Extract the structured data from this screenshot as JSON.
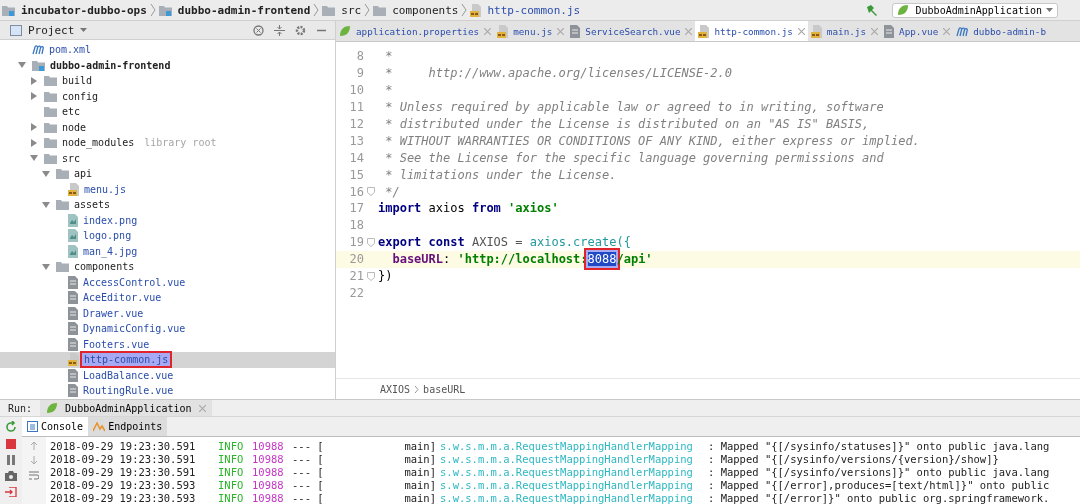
{
  "breadcrumb": [
    {
      "label": "incubator-dubbo-ops",
      "kind": "module"
    },
    {
      "label": "dubbo-admin-frontend",
      "kind": "module"
    },
    {
      "label": "src",
      "kind": "folder"
    },
    {
      "label": "components",
      "kind": "folder"
    },
    {
      "label": "http-common.js",
      "kind": "js"
    }
  ],
  "run_config": {
    "label": "DubboAdminApplication"
  },
  "project_panel": {
    "title": "Project",
    "tree": [
      {
        "label": "pom.xml",
        "kind": "maven",
        "selected": false
      },
      {
        "label": "dubbo-admin-frontend",
        "kind": "module",
        "expanded": true,
        "selected": false,
        "children": [
          {
            "label": "build",
            "kind": "folder",
            "expanded": false,
            "selected": false
          },
          {
            "label": "config",
            "kind": "folder",
            "expanded": false,
            "selected": false
          },
          {
            "label": "etc",
            "kind": "folder",
            "selected": false
          },
          {
            "label": "node",
            "kind": "folder",
            "expanded": false,
            "selected": false
          },
          {
            "label": "node_modules",
            "kind": "folder",
            "expanded": false,
            "selected": false,
            "note": "library root"
          },
          {
            "label": "src",
            "kind": "folder",
            "expanded": true,
            "selected": false,
            "children": [
              {
                "label": "api",
                "kind": "folder",
                "expanded": true,
                "selected": false,
                "children": [
                  {
                    "label": "menu.js",
                    "kind": "js",
                    "selected": false
                  }
                ]
              },
              {
                "label": "assets",
                "kind": "folder",
                "expanded": true,
                "selected": false,
                "children": [
                  {
                    "label": "index.png",
                    "kind": "image",
                    "selected": false
                  },
                  {
                    "label": "logo.png",
                    "kind": "image",
                    "selected": false
                  },
                  {
                    "label": "man_4.jpg",
                    "kind": "image",
                    "selected": false
                  }
                ]
              },
              {
                "label": "components",
                "kind": "folder",
                "expanded": true,
                "selected": false,
                "children": [
                  {
                    "label": "AccessControl.vue",
                    "kind": "vue",
                    "selected": false
                  },
                  {
                    "label": "AceEditor.vue",
                    "kind": "vue",
                    "selected": false
                  },
                  {
                    "label": "Drawer.vue",
                    "kind": "vue",
                    "selected": false
                  },
                  {
                    "label": "DynamicConfig.vue",
                    "kind": "vue",
                    "selected": false
                  },
                  {
                    "label": "Footers.vue",
                    "kind": "vue",
                    "selected": false
                  },
                  {
                    "label": "http-common.js",
                    "kind": "js",
                    "selected": true,
                    "annotated": true
                  },
                  {
                    "label": "LoadBalance.vue",
                    "kind": "vue",
                    "selected": false
                  },
                  {
                    "label": "RoutingRule.vue",
                    "kind": "vue",
                    "selected": false
                  }
                ]
              }
            ]
          }
        ]
      }
    ]
  },
  "editor_tabs": [
    {
      "label": "application.properties",
      "kind": "spring",
      "selected": false,
      "closable": true
    },
    {
      "label": "menu.js",
      "kind": "js",
      "selected": false,
      "closable": true
    },
    {
      "label": "ServiceSearch.vue",
      "kind": "vue",
      "selected": false,
      "closable": true
    },
    {
      "label": "http-common.js",
      "kind": "js",
      "selected": true,
      "closable": true
    },
    {
      "label": "main.js",
      "kind": "js",
      "selected": false,
      "closable": true
    },
    {
      "label": "App.vue",
      "kind": "vue",
      "selected": false,
      "closable": true
    },
    {
      "label": "dubbo-admin-b",
      "kind": "maven",
      "selected": false,
      "closable": false
    }
  ],
  "code_lines": [
    {
      "number": "8",
      "segments": [
        {
          "kind": "comment",
          "text": " *"
        }
      ]
    },
    {
      "number": "9",
      "segments": [
        {
          "kind": "comment",
          "text": " *     http://www.apache.org/licenses/LICENSE-2.0"
        }
      ]
    },
    {
      "number": "10",
      "segments": [
        {
          "kind": "comment",
          "text": " *"
        }
      ]
    },
    {
      "number": "11",
      "segments": [
        {
          "kind": "comment",
          "text": " * Unless required by applicable law or agreed to in writing, software"
        }
      ]
    },
    {
      "number": "12",
      "segments": [
        {
          "kind": "comment",
          "text": " * distributed under the License is distributed on an \"AS IS\" BASIS,"
        }
      ]
    },
    {
      "number": "13",
      "segments": [
        {
          "kind": "comment",
          "text": " * WITHOUT WARRANTIES OR CONDITIONS OF ANY KIND, either express or implied."
        }
      ]
    },
    {
      "number": "14",
      "segments": [
        {
          "kind": "comment",
          "text": " * See the License for the specific language governing permissions and"
        }
      ]
    },
    {
      "number": "15",
      "segments": [
        {
          "kind": "comment",
          "text": " * limitations under the License."
        }
      ]
    },
    {
      "number": "16",
      "fold": true,
      "segments": [
        {
          "kind": "comment",
          "text": " */"
        }
      ]
    },
    {
      "number": "17",
      "segments": [
        {
          "kind": "keyword",
          "text": "import"
        },
        {
          "kind": "plain",
          "text": " axios "
        },
        {
          "kind": "keyword",
          "text": "from"
        },
        {
          "kind": "string",
          "text": " 'axios'"
        }
      ]
    },
    {
      "number": "18"
    },
    {
      "number": "19",
      "fold": true,
      "segments": [
        {
          "kind": "keyword",
          "text": "export"
        },
        {
          "kind": "keyword",
          "text": " const"
        },
        {
          "kind": "constant",
          "text": " AXIOS ="
        },
        {
          "kind": "ident",
          "text": " axios.create({"
        }
      ]
    },
    {
      "number": "20",
      "current": true,
      "segments": [
        {
          "kind": "property",
          "text": "  baseURL"
        },
        {
          "kind": "plain",
          "text": ":"
        },
        {
          "kind": "string",
          "text": " 'http://localhost:"
        },
        {
          "kind": "selection",
          "text": "8088",
          "annotated": true
        },
        {
          "kind": "string",
          "text": "/api'"
        }
      ]
    },
    {
      "number": "21",
      "fold": true,
      "segments": [
        {
          "kind": "plain",
          "text": "})"
        }
      ]
    },
    {
      "number": "22"
    }
  ],
  "editor_breadcrumb": [
    "AXIOS",
    "baseURL"
  ],
  "run_panel": {
    "label": "Run:",
    "tab": "DubboAdminApplication",
    "tabs": [
      {
        "label": "Console",
        "kind": "console",
        "selected": true
      },
      {
        "label": "Endpoints",
        "kind": "endpoints",
        "selected": false
      }
    ],
    "log": [
      {
        "timestamp": "2018-09-29 19:23:30.591",
        "level": "INFO",
        "pid": "10988",
        "separator": "--- [",
        "thread": "main]",
        "logger": "s.w.s.m.m.a.RequestMappingHandlerMapping",
        "message": ": Mapped \"{[/sysinfo/statuses]}\" onto public java.lang"
      },
      {
        "timestamp": "2018-09-29 19:23:30.591",
        "level": "INFO",
        "pid": "10988",
        "separator": "--- [",
        "thread": "main]",
        "logger": "s.w.s.m.m.a.RequestMappingHandlerMapping",
        "message": ": Mapped \"{[/sysinfo/versions/{version}/show]}"
      },
      {
        "timestamp": "2018-09-29 19:23:30.591",
        "level": "INFO",
        "pid": "10988",
        "separator": "--- [",
        "thread": "main]",
        "logger": "s.w.s.m.m.a.RequestMappingHandlerMapping",
        "message": ": Mapped \"{[/sysinfo/versions]}\" onto public java.lang"
      },
      {
        "timestamp": "2018-09-29 19:23:30.593",
        "level": "INFO",
        "pid": "10988",
        "separator": "--- [",
        "thread": "main]",
        "logger": "s.w.s.m.m.a.RequestMappingHandlerMapping",
        "message": ": Mapped \"{[/error],produces=[text/html]}\" onto public"
      },
      {
        "timestamp": "2018-09-29 19:23:30.593",
        "level": "INFO",
        "pid": "10988",
        "separator": "--- [",
        "thread": "main]",
        "logger": "s.w.s.m.m.a.RequestMappingHandlerMapping",
        "message": ": Mapped \"{[/error]}\" onto public org.springframework."
      }
    ]
  }
}
